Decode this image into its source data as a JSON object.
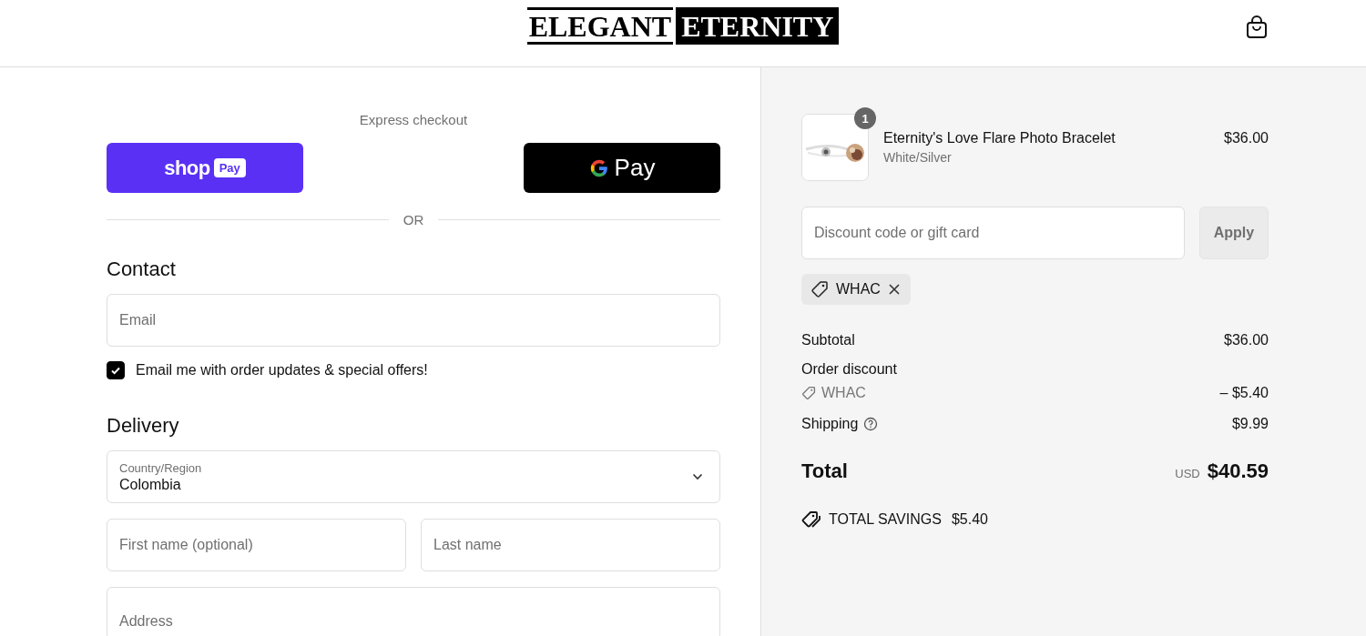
{
  "header": {
    "logo": {
      "first": "ELEGANT",
      "second": "ETERNITY"
    }
  },
  "checkout": {
    "express_title": "Express checkout",
    "express_buttons": [
      {
        "kind": "shop_pay",
        "label": "shop",
        "badge": "Pay"
      },
      {
        "kind": "google_pay",
        "label": "Pay"
      }
    ],
    "divider": "OR",
    "contact": {
      "heading": "Contact",
      "email": {
        "placeholder": "Email"
      },
      "newsletter": {
        "label": "Email me with order updates & special offers!",
        "checked": true
      }
    },
    "delivery": {
      "heading": "Delivery",
      "country": {
        "label": "Country/Region",
        "value": "Colombia"
      },
      "first_name": {
        "placeholder": "First name (optional)"
      },
      "last_name": {
        "placeholder": "Last name"
      },
      "address": {
        "placeholder": "Address"
      }
    }
  },
  "summary": {
    "items": [
      {
        "quantity": "1",
        "name": "Eternity's Love Flare Photo Bracelet",
        "variant": "White/Silver",
        "price": "$36.00"
      }
    ],
    "discount_field": {
      "placeholder": "Discount code or gift card"
    },
    "apply_button": "Apply",
    "applied_codes": [
      "WHAC"
    ],
    "lines": [
      {
        "kind": "plain",
        "label": "Subtotal",
        "value": "$36.00"
      },
      {
        "kind": "heading",
        "label": "Order discount"
      },
      {
        "kind": "code",
        "label": "WHAC",
        "value": "– $5.40"
      },
      {
        "kind": "help",
        "label": "Shipping",
        "value": "$9.99"
      }
    ],
    "total": {
      "label": "Total",
      "currency": "USD",
      "value": "$40.59"
    },
    "savings": {
      "label": "TOTAL SAVINGS",
      "value": "$5.40"
    }
  }
}
